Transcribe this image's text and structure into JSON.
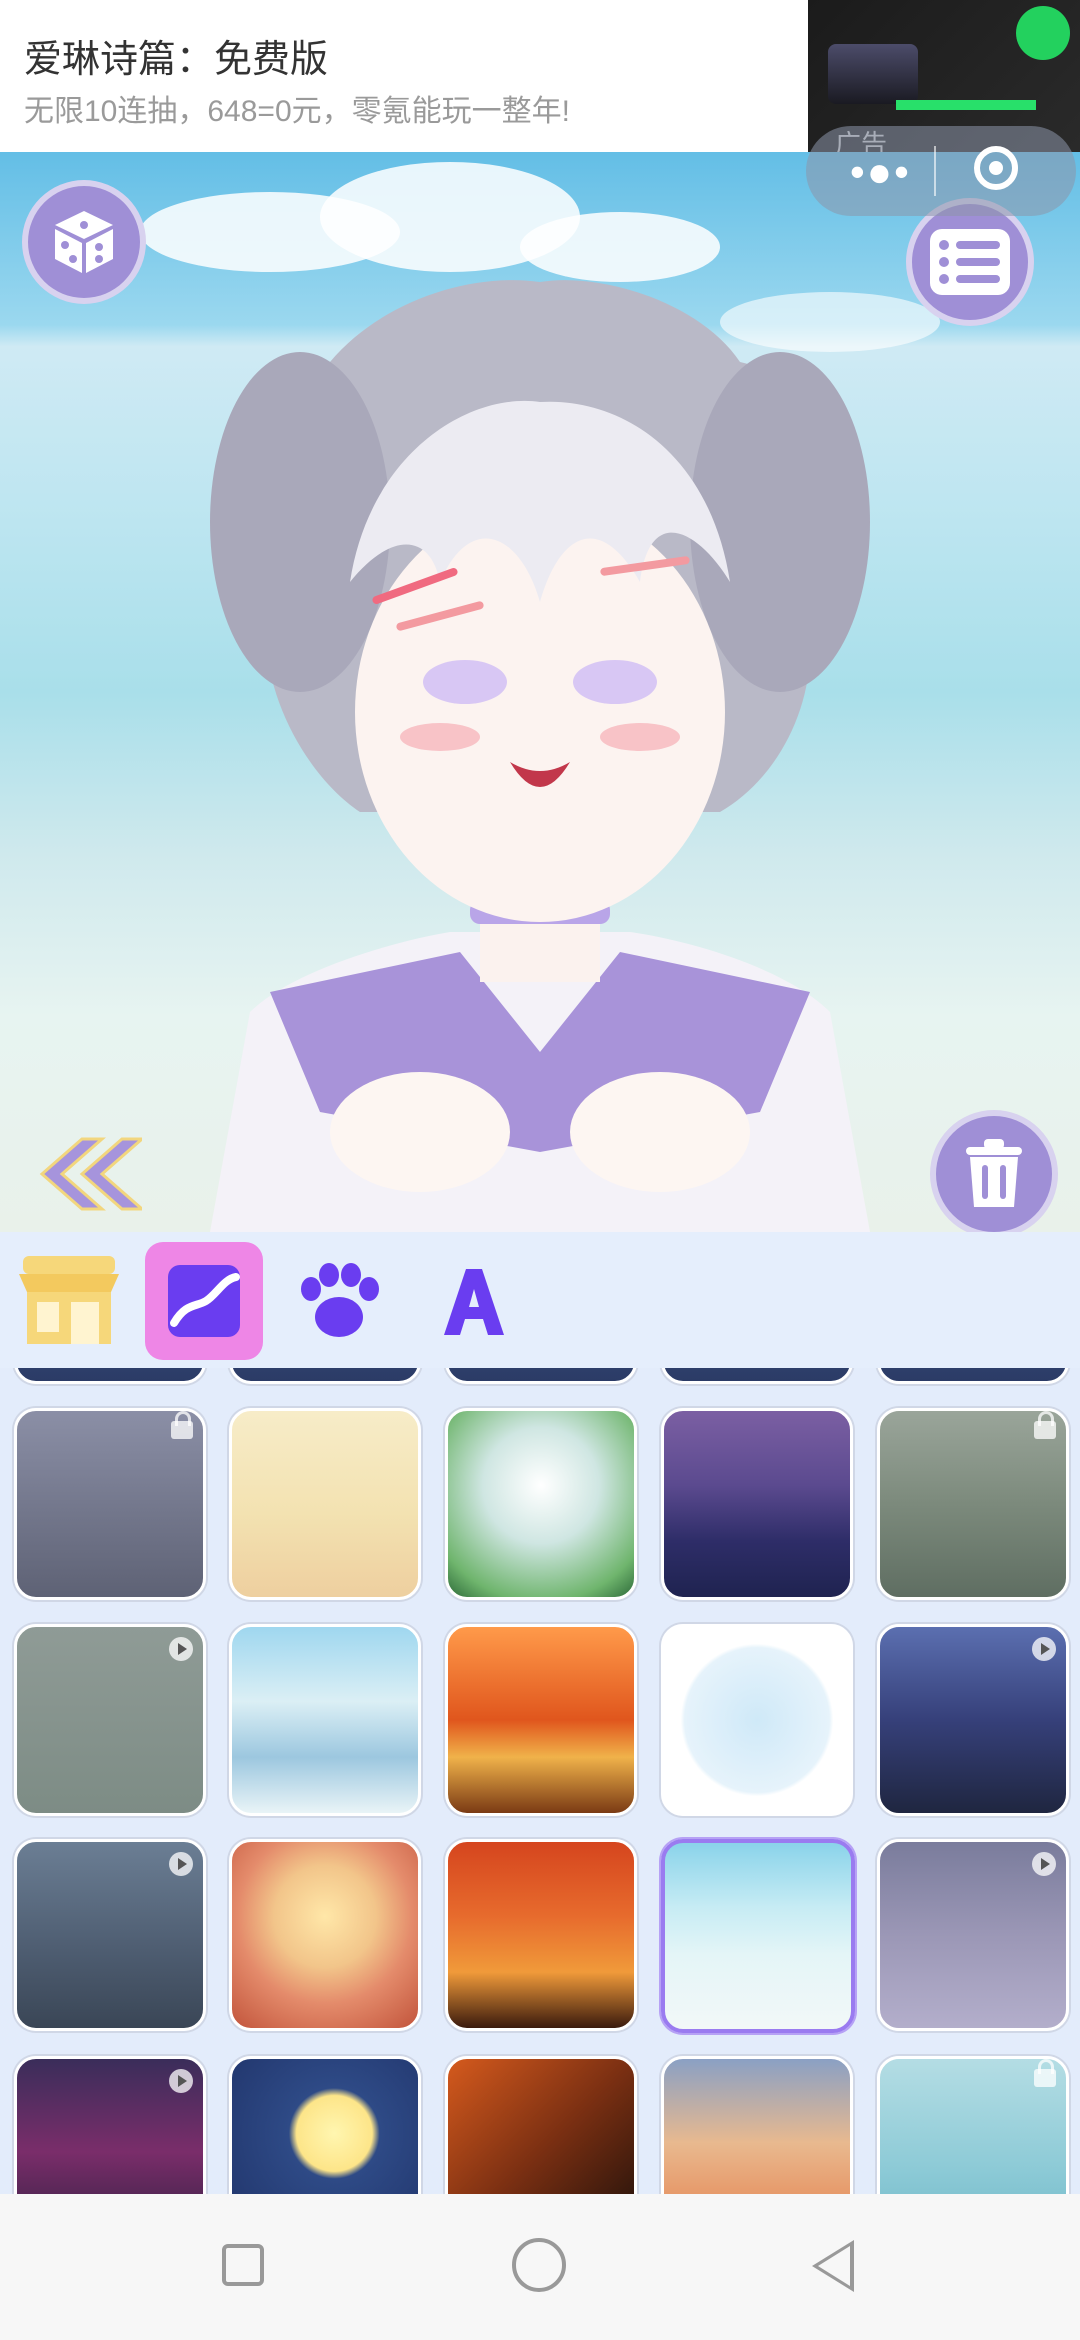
{
  "ad": {
    "title": "爱琳诗篇：免费版",
    "subtitle": "无限10连抽，648=0元，零氪能玩一整年!",
    "label": "广告"
  },
  "toolbar_tabs": [
    {
      "name": "shop",
      "icon": "shop-icon"
    },
    {
      "name": "background",
      "icon": "landscape-icon",
      "active": true
    },
    {
      "name": "pet",
      "icon": "paw-icon"
    },
    {
      "name": "text",
      "icon": "letter-a-icon"
    }
  ],
  "colors": {
    "accent": "#9f8fd6",
    "tab_active": "#ee86e6",
    "panel_bg": "#e5eefc",
    "selected_border": "#9a7bf0"
  },
  "grid": {
    "selected_index": 13,
    "items": [
      {
        "bg": "linear-gradient(180deg,#8b8fa6,#5e6275)",
        "badge": "lock"
      },
      {
        "bg": "linear-gradient(180deg,#f7ecc8 0%,#f3e2b1 55%,#eecf9f 100%)",
        "badge": ""
      },
      {
        "bg": "radial-gradient(circle at 50% 40%,#ffffff 0%,#cfe6e2 40%,#6fb56d 80%,#2e6b3a 100%)",
        "badge": ""
      },
      {
        "bg": "linear-gradient(180deg,#7b5fa3 0%,#5b4a8f 40%,#2e2d68 70%,#1f2350 100%)",
        "badge": ""
      },
      {
        "bg": "linear-gradient(180deg,#9aa59a 0%,#7c8a7c 50%,#5f6e62 100%)",
        "badge": "lock"
      },
      {
        "bg": "linear-gradient(180deg,#8f9b96 0%,#7d8c85 100%)",
        "badge": "play"
      },
      {
        "bg": "linear-gradient(180deg,#9fd7ef 0%,#dbeff5 40%,#9cc7df 70%,#e9f4f7 100%)",
        "badge": ""
      },
      {
        "bg": "linear-gradient(180deg,#ff9a4a 0%,#e0561d 50%,#f0b24a 70%,#7a3a14 100%)",
        "badge": ""
      },
      {
        "bg": "radial-gradient(circle at 50% 50%,#cfe9f8 0%,#e6f3fb 55%,#ffffff 58%,#ffffff 100%)",
        "badge": ""
      },
      {
        "bg": "linear-gradient(180deg,#5b6fb0 0%,#36407a 50%,#1f2640 100%)",
        "badge": "play"
      },
      {
        "bg": "linear-gradient(180deg,#6b7e94 0%,#4d5c70 60%,#3a4656 100%)",
        "badge": "play"
      },
      {
        "bg": "radial-gradient(circle at 50% 40%,#ffe7a8 0%,#f2c58a 35%,#e48b6b 60%,#c2543b 100%)",
        "badge": ""
      },
      {
        "bg": "linear-gradient(180deg,#d5451e 0%,#e76b2d 40%,#f09a3a 70%,#3a1a0d 100%)",
        "badge": ""
      },
      {
        "bg": "linear-gradient(180deg,#8ad3ea 0%,#c7ecf4 35%,#e4f5f7 60%,#f2f8f8 100%)",
        "badge": ""
      },
      {
        "bg": "linear-gradient(180deg,#7a7c9c 0%,#9b97b6 50%,#b3aecb 100%)",
        "badge": "play"
      },
      {
        "bg": "linear-gradient(180deg,#3a2d5a 0%,#7a2d6a 50%,#2f2040 100%)",
        "badge": "play"
      },
      {
        "bg": "radial-gradient(circle at 55% 40%,#fff6b0 0%,#fde589 25%,#2e4a86 30%,#1f3268 100%)",
        "badge": ""
      },
      {
        "bg": "linear-gradient(135deg,#d55a1d 0%,#7a2f12 50%,#1a0f0a 100%)",
        "badge": ""
      },
      {
        "bg": "linear-gradient(180deg,#8aa0c4 0%,#e8b98f 45%,#e79d6e 70%,#d58153 100%)",
        "badge": ""
      },
      {
        "bg": "linear-gradient(180deg,#b4dde4 0%,#8ccad6 60%,#6fb7c7 100%)",
        "badge": "lock"
      }
    ]
  },
  "navbar": {
    "buttons": [
      "recents-button",
      "home-button",
      "back-button"
    ]
  }
}
